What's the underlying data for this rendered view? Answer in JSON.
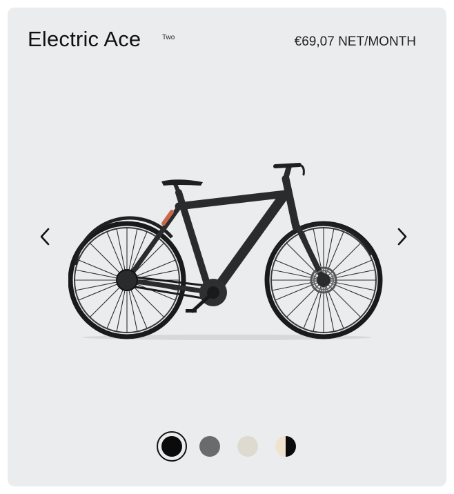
{
  "product": {
    "name": "Electric Ace",
    "variant": "Two",
    "price": "€69,07 NET/MONTH"
  },
  "carousel": {
    "prev_icon": "chevron-left-icon",
    "next_icon": "chevron-right-icon",
    "image": "bike-image"
  },
  "colors": [
    {
      "name": "black",
      "hex": "#0b0b0b",
      "selected": true
    },
    {
      "name": "grey",
      "hex": "#6b6b6b",
      "selected": false
    },
    {
      "name": "sand",
      "hex": "#dedad0",
      "selected": false
    },
    {
      "name": "sand-black",
      "hex_left": "#efe3cf",
      "hex_right": "#0b0b0b",
      "selected": false
    }
  ],
  "theme": {
    "card_bg": "#ebecee",
    "accent_frame": "#c9694c",
    "bike": "#2a2b2d"
  }
}
